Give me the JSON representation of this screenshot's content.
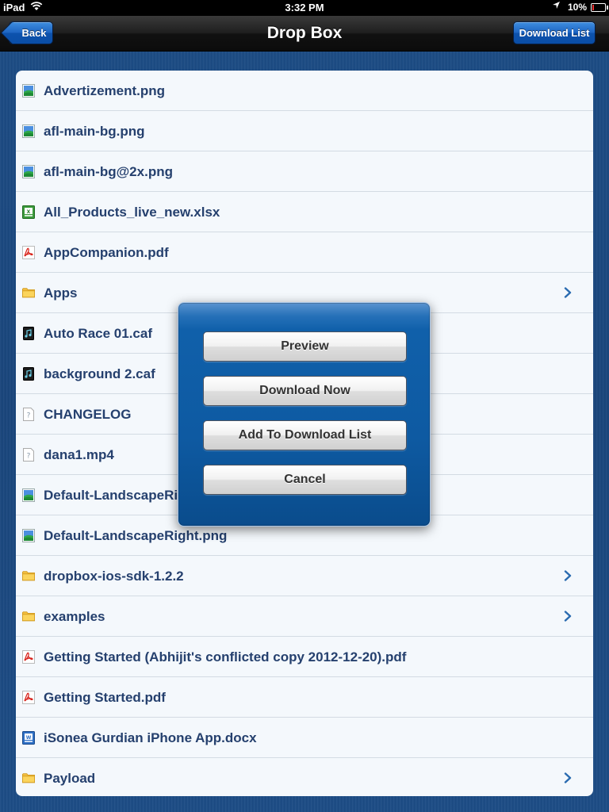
{
  "status_bar": {
    "carrier": "iPad",
    "time": "3:32 PM",
    "battery": "10%"
  },
  "nav": {
    "back_label": "Back",
    "title": "Drop Box",
    "download_list_label": "Download List"
  },
  "files": [
    {
      "name": "Advertizement.png",
      "icon": "image-file-icon",
      "folder": false
    },
    {
      "name": "afl-main-bg.png",
      "icon": "image-file-icon",
      "folder": false
    },
    {
      "name": "afl-main-bg@2x.png",
      "icon": "image-file-icon",
      "folder": false
    },
    {
      "name": "All_Products_live_new.xlsx",
      "icon": "excel-file-icon",
      "folder": false
    },
    {
      "name": "AppCompanion.pdf",
      "icon": "pdf-file-icon",
      "folder": false
    },
    {
      "name": "Apps",
      "icon": "folder-icon",
      "folder": true
    },
    {
      "name": "Auto Race 01.caf",
      "icon": "audio-file-icon",
      "folder": false
    },
    {
      "name": "background 2.caf",
      "icon": "audio-file-icon",
      "folder": false
    },
    {
      "name": "CHANGELOG",
      "icon": "unknown-file-icon",
      "folder": false
    },
    {
      "name": "dana1.mp4",
      "icon": "unknown-file-icon",
      "folder": false
    },
    {
      "name": "Default-LandscapeRight.png",
      "icon": "image-file-icon",
      "folder": false
    },
    {
      "name": "Default-LandscapeRight.png",
      "icon": "image-file-icon",
      "folder": false
    },
    {
      "name": "dropbox-ios-sdk-1.2.2",
      "icon": "folder-icon",
      "folder": true
    },
    {
      "name": "examples",
      "icon": "folder-icon",
      "folder": true
    },
    {
      "name": "Getting Started (Abhijit's conflicted copy 2012-12-20).pdf",
      "icon": "pdf-file-icon",
      "folder": false
    },
    {
      "name": "Getting Started.pdf",
      "icon": "pdf-file-icon",
      "folder": false
    },
    {
      "name": "iSonea Gurdian iPhone App.docx",
      "icon": "word-file-icon",
      "folder": false
    },
    {
      "name": "Payload",
      "icon": "folder-icon",
      "folder": true
    }
  ],
  "popover": {
    "preview_label": "Preview",
    "download_now_label": "Download Now",
    "add_to_list_label": "Add To Download List",
    "cancel_label": "Cancel"
  },
  "colors": {
    "nav_button_blue": "#1d64c2",
    "list_text": "#25406e",
    "background_blue": "#1c4a80",
    "popover_blue": "#0e5aa2"
  }
}
